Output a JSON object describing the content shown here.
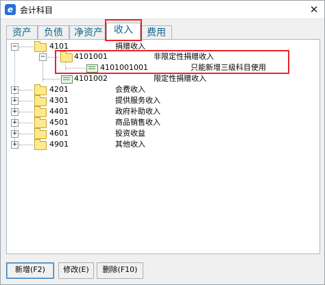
{
  "window": {
    "title": "会计科目",
    "close_glyph": "✕",
    "app_icon": "e"
  },
  "tabs": [
    {
      "label": "资产"
    },
    {
      "label": "负债"
    },
    {
      "label": "净资产"
    },
    {
      "label": "收入",
      "active": true
    },
    {
      "label": "费用"
    }
  ],
  "tree": {
    "expanded_glyph": "−",
    "collapsed_glyph": "+",
    "rows": [
      {
        "code": "4101",
        "name": "捐赠收入",
        "state": "expanded",
        "icon": "folder-icon"
      },
      {
        "code": "4101001",
        "name": "非限定性捐赠收入",
        "state": "expanded",
        "icon": "folder-icon"
      },
      {
        "code": "4101001001",
        "name": "只能新增三级科目使用",
        "state": "leaf",
        "icon": "ledger-icon"
      },
      {
        "code": "4101002",
        "name": "限定性捐赠收入",
        "state": "leaf",
        "icon": "ledger-icon"
      },
      {
        "code": "4201",
        "name": "会费收入",
        "state": "collapsed",
        "icon": "folder-icon"
      },
      {
        "code": "4301",
        "name": "提供服务收入",
        "state": "collapsed",
        "icon": "folder-icon"
      },
      {
        "code": "4401",
        "name": "政府补助收入",
        "state": "collapsed",
        "icon": "folder-icon"
      },
      {
        "code": "4501",
        "name": "商品销售收入",
        "state": "collapsed",
        "icon": "folder-icon"
      },
      {
        "code": "4601",
        "name": "投资收益",
        "state": "collapsed",
        "icon": "folder-icon"
      },
      {
        "code": "4901",
        "name": "其他收入",
        "state": "collapsed",
        "icon": "folder-icon"
      }
    ]
  },
  "buttons": {
    "add": "新增(F2)",
    "edit": "修改(E)",
    "delete": "删除(F10)"
  },
  "colors": {
    "highlight": "#e8232a",
    "tab_text": "#10668f"
  }
}
